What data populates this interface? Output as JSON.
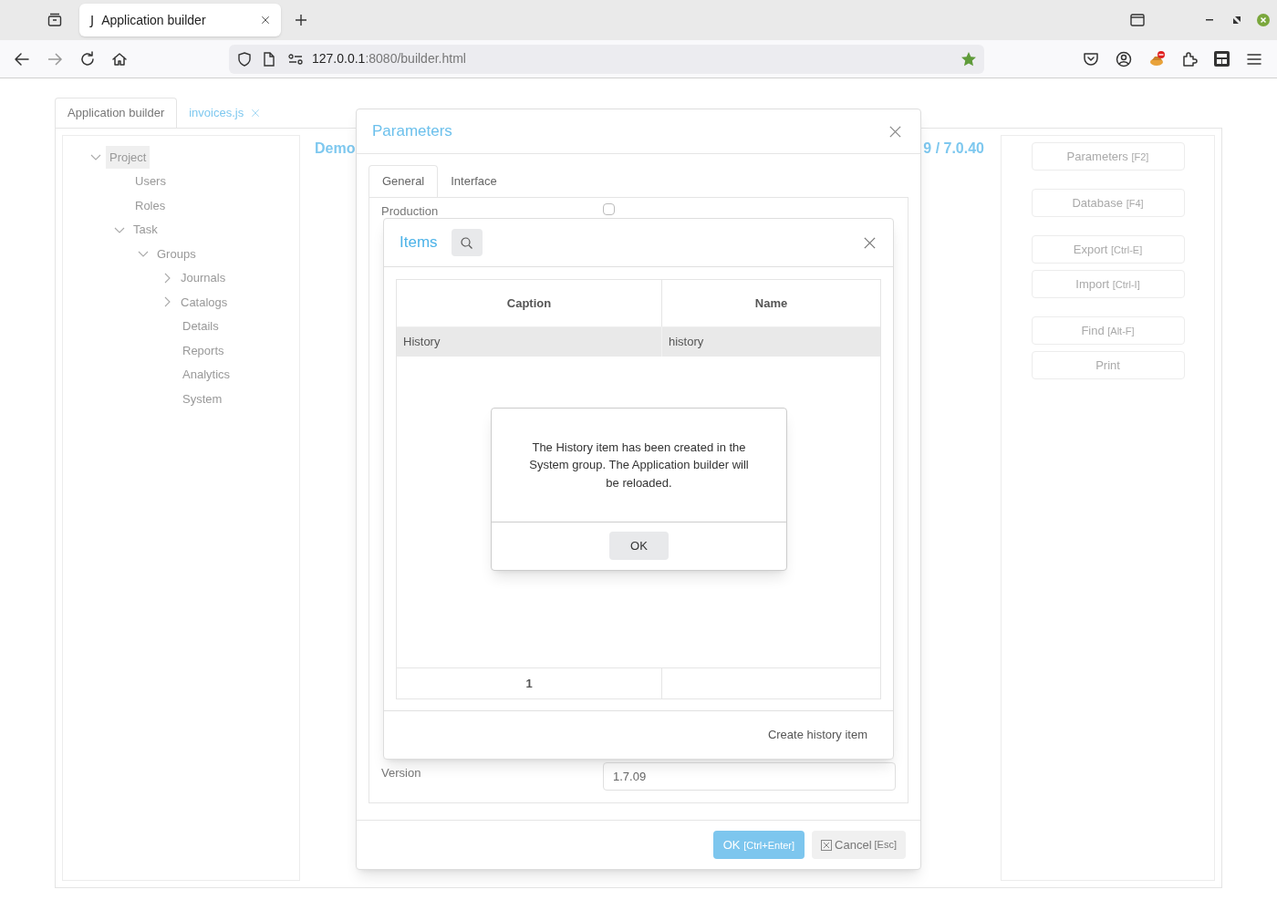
{
  "browser": {
    "tab_icon": "J",
    "tab_title": "Application builder",
    "url_host": "127.0.0.1",
    "url_rest": ":8080/builder.html"
  },
  "app_tabs": [
    {
      "label": "Application builder",
      "selected": true,
      "closable": false
    },
    {
      "label": "invoices.js",
      "selected": false,
      "closable": true
    }
  ],
  "tree": [
    {
      "label": "Project",
      "kind": "branch",
      "expanded": true,
      "selected": true,
      "children": [
        {
          "label": "Users",
          "kind": "leaf",
          "selected": false
        },
        {
          "label": "Roles",
          "kind": "leaf",
          "selected": false
        },
        {
          "label": "Task",
          "kind": "branch",
          "expanded": true,
          "selected": false,
          "children": [
            {
              "label": "Groups",
              "kind": "branch",
              "expanded": true,
              "selected": false,
              "children": [
                {
                  "label": "Journals",
                  "kind": "branch",
                  "expanded": false,
                  "selected": false
                },
                {
                  "label": "Catalogs",
                  "kind": "branch",
                  "expanded": false,
                  "selected": false
                },
                {
                  "label": "Details",
                  "kind": "leaf",
                  "selected": false
                },
                {
                  "label": "Reports",
                  "kind": "leaf",
                  "selected": false
                },
                {
                  "label": "Analytics",
                  "kind": "leaf",
                  "selected": false
                },
                {
                  "label": "System",
                  "kind": "leaf",
                  "selected": false
                }
              ]
            }
          ]
        }
      ]
    }
  ],
  "heading": {
    "left_part": "Demo",
    "right_part": "9 / 7.0.40"
  },
  "action_groups": [
    [
      {
        "label": "Parameters",
        "shortcut": "[F2]"
      }
    ],
    [
      {
        "label": "Database",
        "shortcut": "[F4]"
      }
    ],
    [
      {
        "label": "Export",
        "shortcut": "[Ctrl-E]"
      },
      {
        "label": "Import",
        "shortcut": "[Ctrl-I]"
      }
    ],
    [
      {
        "label": "Find",
        "shortcut": "[Alt-F]"
      },
      {
        "label": "Print"
      }
    ]
  ],
  "parameters_dialog": {
    "title": "Parameters",
    "tabs": [
      {
        "label": "General",
        "selected": true
      },
      {
        "label": "Interface",
        "selected": false
      }
    ],
    "production": {
      "label": "Production",
      "checked": false
    },
    "version": {
      "label": "Version",
      "value": "1.7.09"
    },
    "ok": {
      "label": "OK",
      "shortcut": "[Ctrl+Enter]"
    },
    "cancel": {
      "label": "Cancel",
      "shortcut": "[Esc]"
    }
  },
  "items_dialog": {
    "title": "Items",
    "columns": [
      "Caption",
      "Name"
    ],
    "rows": [
      {
        "caption": "History",
        "name": "history",
        "selected": true
      }
    ],
    "footer": [
      "1"
    ],
    "action": "Create history item"
  },
  "message": {
    "text": "The History item has been created in the System group. The Application builder will be reloaded.",
    "button": "OK"
  }
}
